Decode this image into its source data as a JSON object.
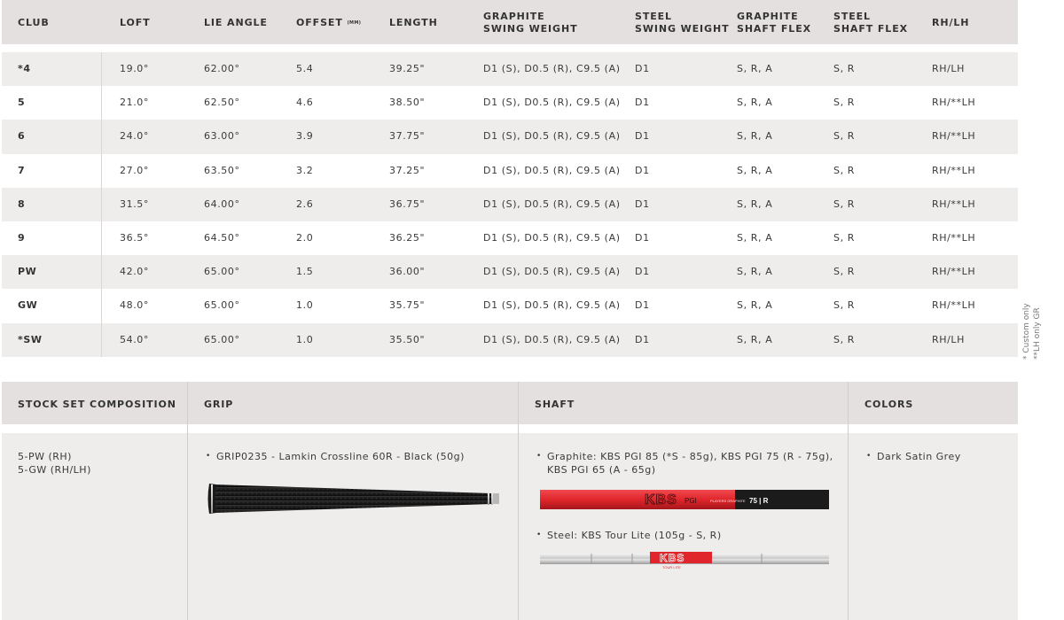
{
  "spec_table": {
    "headers": {
      "club": "CLUB",
      "loft": "LOFT",
      "lie_angle": "LIE ANGLE",
      "offset": "OFFSET",
      "offset_unit": "(MM)",
      "length": "LENGTH",
      "graphite_sw_1": "GRAPHITE",
      "graphite_sw_2": "SWING WEIGHT",
      "steel_sw_1": "STEEL",
      "steel_sw_2": "SWING WEIGHT",
      "graphite_flex_1": "GRAPHITE",
      "graphite_flex_2": "SHAFT FLEX",
      "steel_flex_1": "STEEL",
      "steel_flex_2": "SHAFT FLEX",
      "hand": "RH/LH"
    },
    "rows": [
      {
        "club": "*4",
        "loft": "19.0°",
        "lie": "62.00°",
        "offset": "5.4",
        "length": "39.25\"",
        "graphite_sw": "D1 (S), D0.5 (R), C9.5 (A)",
        "steel_sw": "D1",
        "graphite_flex": "S, R, A",
        "steel_flex": "S, R",
        "hand": "RH/LH"
      },
      {
        "club": "5",
        "loft": "21.0°",
        "lie": "62.50°",
        "offset": "4.6",
        "length": "38.50\"",
        "graphite_sw": "D1 (S), D0.5 (R), C9.5 (A)",
        "steel_sw": "D1",
        "graphite_flex": "S, R, A",
        "steel_flex": "S, R",
        "hand": "RH/**LH"
      },
      {
        "club": "6",
        "loft": "24.0°",
        "lie": "63.00°",
        "offset": "3.9",
        "length": "37.75\"",
        "graphite_sw": "D1 (S), D0.5 (R), C9.5 (A)",
        "steel_sw": "D1",
        "graphite_flex": "S, R, A",
        "steel_flex": "S, R",
        "hand": "RH/**LH"
      },
      {
        "club": "7",
        "loft": "27.0°",
        "lie": "63.50°",
        "offset": "3.2",
        "length": "37.25\"",
        "graphite_sw": "D1 (S), D0.5 (R), C9.5 (A)",
        "steel_sw": "D1",
        "graphite_flex": "S, R, A",
        "steel_flex": "S, R",
        "hand": "RH/**LH"
      },
      {
        "club": "8",
        "loft": "31.5°",
        "lie": "64.00°",
        "offset": "2.6",
        "length": "36.75\"",
        "graphite_sw": "D1 (S), D0.5 (R), C9.5 (A)",
        "steel_sw": "D1",
        "graphite_flex": "S, R, A",
        "steel_flex": "S, R",
        "hand": "RH/**LH"
      },
      {
        "club": "9",
        "loft": "36.5°",
        "lie": "64.50°",
        "offset": "2.0",
        "length": "36.25\"",
        "graphite_sw": "D1 (S), D0.5 (R), C9.5 (A)",
        "steel_sw": "D1",
        "graphite_flex": "S, R, A",
        "steel_flex": "S, R",
        "hand": "RH/**LH"
      },
      {
        "club": "PW",
        "loft": "42.0°",
        "lie": "65.00°",
        "offset": "1.5",
        "length": "36.00\"",
        "graphite_sw": "D1 (S), D0.5 (R), C9.5 (A)",
        "steel_sw": "D1",
        "graphite_flex": "S, R, A",
        "steel_flex": "S, R",
        "hand": "RH/**LH"
      },
      {
        "club": "GW",
        "loft": "48.0°",
        "lie": "65.00°",
        "offset": "1.0",
        "length": "35.75\"",
        "graphite_sw": "D1 (S), D0.5 (R), C9.5 (A)",
        "steel_sw": "D1",
        "graphite_flex": "S, R, A",
        "steel_flex": "S, R",
        "hand": "RH/**LH"
      },
      {
        "club": "*SW",
        "loft": "54.0°",
        "lie": "65.00°",
        "offset": "1.0",
        "length": "35.50\"",
        "graphite_sw": "D1 (S), D0.5 (R), C9.5 (A)",
        "steel_sw": "D1",
        "graphite_flex": "S, R, A",
        "steel_flex": "S, R",
        "hand": "RH/LH"
      }
    ]
  },
  "side_note": {
    "custom": "* Custom only",
    "lh": "**LH only GR"
  },
  "composition": {
    "headers": {
      "stock": "STOCK SET COMPOSITION",
      "grip": "GRIP",
      "shaft": "SHAFT",
      "colors": "COLORS"
    },
    "stock_lines": [
      "5-PW (RH)",
      "5-GW (RH/LH)"
    ],
    "grip_item": "GRIP0235 - Lamkin Crossline 60R - Black (50g)",
    "shaft_graphite_line1": "Graphite: KBS PGI 85 (*S - 85g), KBS PGI 75 (R - 75g),",
    "shaft_graphite_line2": "KBS PGI 65 (A - 65g)",
    "shaft_steel": "Steel: KBS Tour Lite (105g - S, R)",
    "color_item": "Dark Satin Grey",
    "graphite_shaft_label_brand": "KBS",
    "graphite_shaft_label_model": "PGI",
    "graphite_shaft_label_sub": "PLAYERS GRAPHITE",
    "graphite_shaft_label_weight": "75 | R",
    "steel_shaft_label_brand": "KBS",
    "steel_shaft_label_sub": "TOUR LITE",
    "accent_red": "#e0262c",
    "grip_color": "#1f1f1f"
  }
}
